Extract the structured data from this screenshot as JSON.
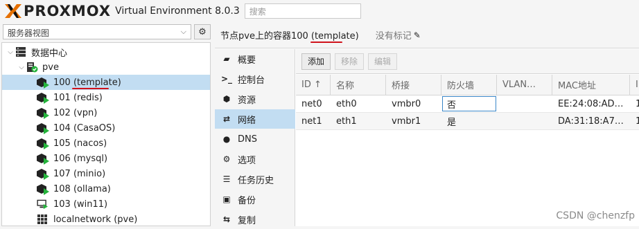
{
  "app": {
    "logo_text": "PROXMOX",
    "product": "Virtual Environment 8.0.3",
    "search_placeholder": "搜索"
  },
  "left": {
    "view_select": "服务器视图",
    "tree": [
      {
        "label": "数据中心",
        "type": "datacenter"
      },
      {
        "label": "pve",
        "type": "node"
      },
      {
        "label": "100 (template)",
        "type": "container"
      },
      {
        "label": "101 (redis)",
        "type": "container"
      },
      {
        "label": "102 (vpn)",
        "type": "container"
      },
      {
        "label": "104 (CasaOS)",
        "type": "container"
      },
      {
        "label": "105 (nacos)",
        "type": "container"
      },
      {
        "label": "106 (mysql)",
        "type": "container"
      },
      {
        "label": "107 (minio)",
        "type": "container"
      },
      {
        "label": "108 (ollama)",
        "type": "container"
      },
      {
        "label": "103 (win11)",
        "type": "vm"
      },
      {
        "label": "localnetwork (pve)",
        "type": "network"
      }
    ]
  },
  "right": {
    "title": "节点pve上的容器100 (template)",
    "tags_label": "没有标记",
    "nav": [
      {
        "label": "概要",
        "icon": "book-icon"
      },
      {
        "label": "控制台",
        "icon": "terminal-icon"
      },
      {
        "label": "资源",
        "icon": "cube-icon"
      },
      {
        "label": "网络",
        "icon": "exchange-icon"
      },
      {
        "label": "DNS",
        "icon": "globe-icon"
      },
      {
        "label": "选项",
        "icon": "gear-icon"
      },
      {
        "label": "任务历史",
        "icon": "list-icon"
      },
      {
        "label": "备份",
        "icon": "save-icon"
      },
      {
        "label": "复制",
        "icon": "retweet-icon"
      }
    ],
    "toolbar": {
      "add": "添加",
      "remove": "移除",
      "edit": "编辑"
    },
    "columns": [
      "ID ↑",
      "名称",
      "桥接",
      "防火墙",
      "VLAN…",
      "MAC地址",
      "I"
    ],
    "rows": [
      [
        "net0",
        "eth0",
        "vmbr0",
        "否",
        "",
        "EE:24:08:AD…",
        "1"
      ],
      [
        "net1",
        "eth1",
        "vmbr1",
        "是",
        "",
        "DA:31:18:A7…",
        "1"
      ]
    ]
  },
  "watermark": "CSDN @chenzfp",
  "colors": {
    "selected": "#c2ddf2",
    "accent_orange": "#e57000",
    "running_green": "#24b33b",
    "annotation_red": "#d0121b"
  }
}
